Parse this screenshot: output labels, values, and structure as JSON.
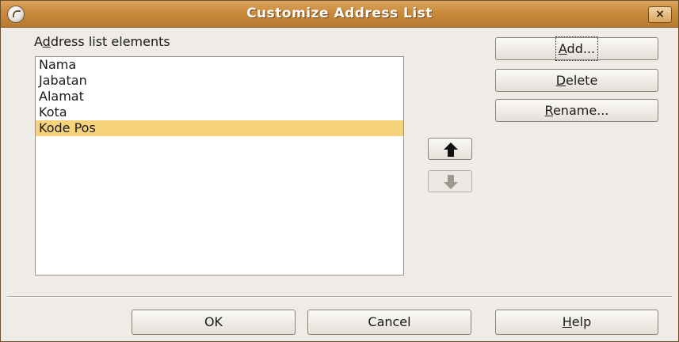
{
  "window": {
    "title": "Customize Address List",
    "close_icon": "×"
  },
  "list": {
    "label_prefix": "A",
    "label_accel": "d",
    "label_rest": "dress list elements",
    "items": [
      "Nama",
      "Jabatan",
      "Alamat",
      "Kota",
      "Kode Pos"
    ],
    "selected_item": "Kode Pos"
  },
  "side_buttons": {
    "add": {
      "accel": "A",
      "rest": "dd..."
    },
    "delete": {
      "accel": "D",
      "rest": "elete"
    },
    "rename": {
      "accel": "R",
      "rest": "ename..."
    }
  },
  "move_buttons": {
    "up_icon": "arrow-up-icon",
    "down_icon": "arrow-down-icon",
    "down_disabled": true
  },
  "footer": {
    "ok_label": "OK",
    "cancel_label": "Cancel",
    "help_accel": "H",
    "help_rest": "elp"
  },
  "colors": {
    "titlebar": "#c98a3c",
    "selection": "#f6d27a",
    "dialog_bg": "#efebe7"
  }
}
